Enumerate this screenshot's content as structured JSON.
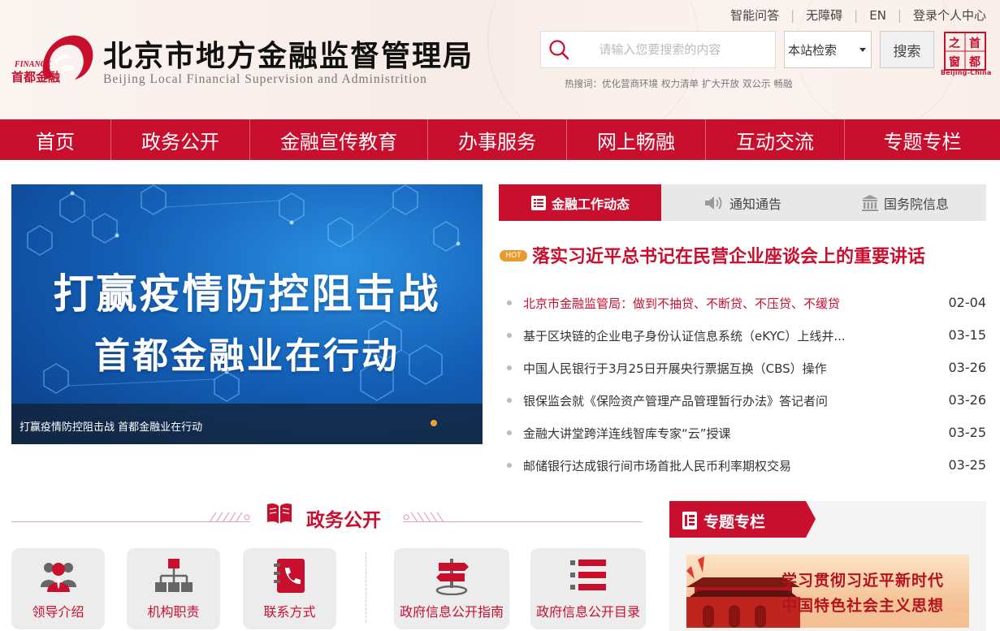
{
  "header": {
    "logo_text": "首都金融",
    "logo_finance": "FINANCE",
    "title": "北京市地方金融监督管理局",
    "subtitle": "Beijing Local Financial Supervision and Administrition",
    "toplinks": [
      "智能问答",
      "无障碍",
      "EN",
      "登录个人中心"
    ],
    "search_placeholder": "请输入您要搜索的内容",
    "search_scope": "本站检索",
    "search_button": "搜索",
    "hotwords_label": "热搜词：",
    "hotwords": [
      "优化营商环境",
      "权力清单",
      "扩大开放",
      "双公示",
      "畅融"
    ],
    "capital_logo_chars": [
      "首",
      "都",
      "之",
      "窗"
    ],
    "capital_logo_caption": "Beijing-China"
  },
  "nav": {
    "items": [
      "首页",
      "政务公开",
      "金融宣传教育",
      "办事服务",
      "网上畅融",
      "互动交流",
      "专题专栏"
    ]
  },
  "banner": {
    "line1": "打赢疫情防控阻击战",
    "line2": "首都金融业在行动",
    "caption": "打赢疫情防控阻击战 首都金融业在行动"
  },
  "news": {
    "tabs": [
      {
        "label": "金融工作动态",
        "icon": "list-icon",
        "active": true
      },
      {
        "label": "通知通告",
        "icon": "speaker-icon",
        "active": false
      },
      {
        "label": "国务院信息",
        "icon": "government-building-icon",
        "active": false
      }
    ],
    "hot_badge": "HOT",
    "headline": "落实习近平总书记在民营企业座谈会上的重要讲话",
    "items": [
      {
        "title": "北京市金融监管局：做到不抽贷、不断贷、不压贷、不缓贷",
        "date": "02-04"
      },
      {
        "title": "基于区块链的企业电子身份认证信息系统（eKYC）上线并...",
        "date": "03-15"
      },
      {
        "title": "中国人民银行于3月25日开展央行票据互换（CBS）操作",
        "date": "03-26"
      },
      {
        "title": "银保监会就《保险资产管理产品管理暂行办法》答记者问",
        "date": "03-26"
      },
      {
        "title": "金融大讲堂跨洋连线智库专家“云”授课",
        "date": "03-25"
      },
      {
        "title": "邮储银行达成银行间市场首批人民币利率期权交易",
        "date": "03-25"
      }
    ]
  },
  "zwgk": {
    "title": "政务公开",
    "cards": [
      {
        "label": "领导介绍",
        "icon": "leaders-icon"
      },
      {
        "label": "机构职责",
        "icon": "org-chart-icon"
      },
      {
        "label": "联系方式",
        "icon": "phone-book-icon"
      },
      {
        "label": "政府信息公开指南",
        "icon": "signpost-icon"
      },
      {
        "label": "政府信息公开目录",
        "icon": "catalog-list-icon"
      }
    ]
  },
  "zhuanti": {
    "title": "专题专栏",
    "banner_line1": "学习贯彻习近平新时代",
    "banner_line2": "中国特色社会主义思想"
  },
  "colors": {
    "brand_red": "#c8102e",
    "tab_gray": "#e8e8e8",
    "hot_orange": "#e99a2e",
    "banner_blue": "#1460b8"
  }
}
